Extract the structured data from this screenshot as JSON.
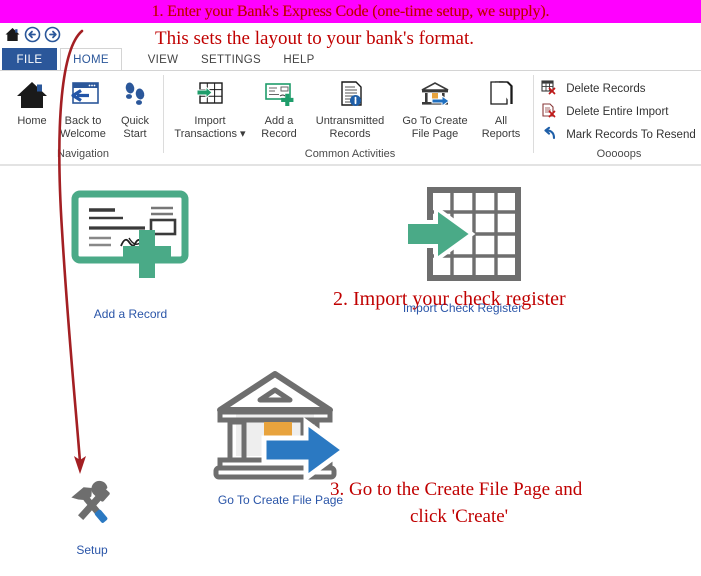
{
  "banner": {
    "text": "1. Enter your Bank's Express Code (one-time setup, we supply).",
    "bg_color": "#ff00ff",
    "text_color": "#c00000"
  },
  "annotations": [
    {
      "id": "ann_layout",
      "text": "This sets the layout to your bank's format.",
      "color": "#c00000"
    },
    {
      "id": "ann_import",
      "text": "2. Import your check register",
      "color": "#c00000"
    },
    {
      "id": "ann_create_1",
      "text": "3. Go to the Create File Page and",
      "color": "#c00000"
    },
    {
      "id": "ann_create_2",
      "text": "click 'Create'",
      "color": "#c00000"
    }
  ],
  "quick_access": {
    "home_icon": "home-icon",
    "back_icon": "back-arrow-icon",
    "forward_icon": "forward-arrow-icon"
  },
  "tabs": {
    "file_label": "FILE",
    "items": [
      {
        "label": "HOME",
        "active": true
      },
      {
        "label": "VIEW",
        "active": false
      },
      {
        "label": "SETTINGS",
        "active": false
      },
      {
        "label": "HELP",
        "active": false
      }
    ]
  },
  "ribbon": {
    "groups": [
      {
        "name": "Navigation",
        "buttons": [
          {
            "line1": "Home",
            "line2": "",
            "icon": "home-icon"
          },
          {
            "line1": "Back to",
            "line2": "Welcome",
            "icon": "back-to-welcome-icon"
          },
          {
            "line1": "Quick",
            "line2": "Start",
            "icon": "footsteps-icon"
          }
        ]
      },
      {
        "name": "Common Activities",
        "buttons": [
          {
            "line1": "Import",
            "line2": "Transactions ▾",
            "icon": "import-grid-icon"
          },
          {
            "line1": "Add a",
            "line2": "Record",
            "icon": "add-check-icon"
          },
          {
            "line1": "Untransmitted",
            "line2": "Records",
            "icon": "document-info-icon"
          },
          {
            "line1": "Go To Create",
            "line2": "File Page",
            "icon": "bank-arrow-icon"
          },
          {
            "line1": "All",
            "line2": "Reports",
            "icon": "pages-icon"
          }
        ]
      },
      {
        "name": "Ooooops",
        "small_buttons": [
          {
            "label": "Delete Records",
            "icon": "delete-grid-icon"
          },
          {
            "label": "Delete Entire Import",
            "icon": "delete-document-icon"
          },
          {
            "label": "Mark Records To Resend",
            "icon": "undo-arrow-icon"
          }
        ]
      }
    ]
  },
  "content": {
    "tiles": [
      {
        "id": "add-record",
        "caption": "Add a Record",
        "icon": "check-plus-icon"
      },
      {
        "id": "import-check-register",
        "caption": "Import Check Register",
        "icon": "grid-arrow-icon"
      },
      {
        "id": "go-to-create-file-page",
        "caption": "Go To Create File Page",
        "icon": "bank-arrow-icon"
      },
      {
        "id": "setup",
        "caption": "Setup",
        "icon": "tools-icon"
      }
    ]
  },
  "colors": {
    "accent_blue": "#2b579a",
    "link_blue": "#2a55a8",
    "green": "#4aaa87",
    "red": "#c00000",
    "magenta": "#ff00ff",
    "gray": "#6e6e6e",
    "orange": "#e8a33d"
  }
}
